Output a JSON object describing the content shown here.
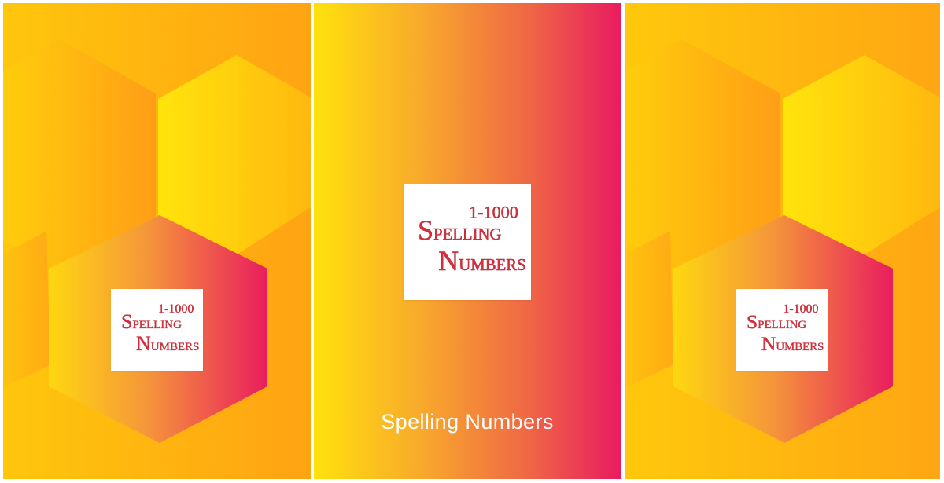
{
  "screens": [
    {
      "id": "hex-screen-left",
      "logo": {
        "range": "1-1000",
        "word1_initial": "S",
        "word1_rest": "PELLING",
        "word2_initial": "N",
        "word2_rest": "UMBERS"
      }
    },
    {
      "id": "splash-screen",
      "logo": {
        "range": "1-1000",
        "word1_initial": "S",
        "word1_rest": "PELLING",
        "word2_initial": "N",
        "word2_rest": "UMBERS"
      },
      "app_title": "Spelling Numbers"
    },
    {
      "id": "hex-screen-right",
      "logo": {
        "range": "1-1000",
        "word1_initial": "S",
        "word1_rest": "PELLING",
        "word2_initial": "N",
        "word2_rest": "UMBERS"
      }
    }
  ],
  "colors": {
    "yellow": "#ffe20e",
    "orange": "#fea81a",
    "pink": "#e91b5f",
    "logo_red": "#d92c3a",
    "title_text": "#ffffff"
  }
}
